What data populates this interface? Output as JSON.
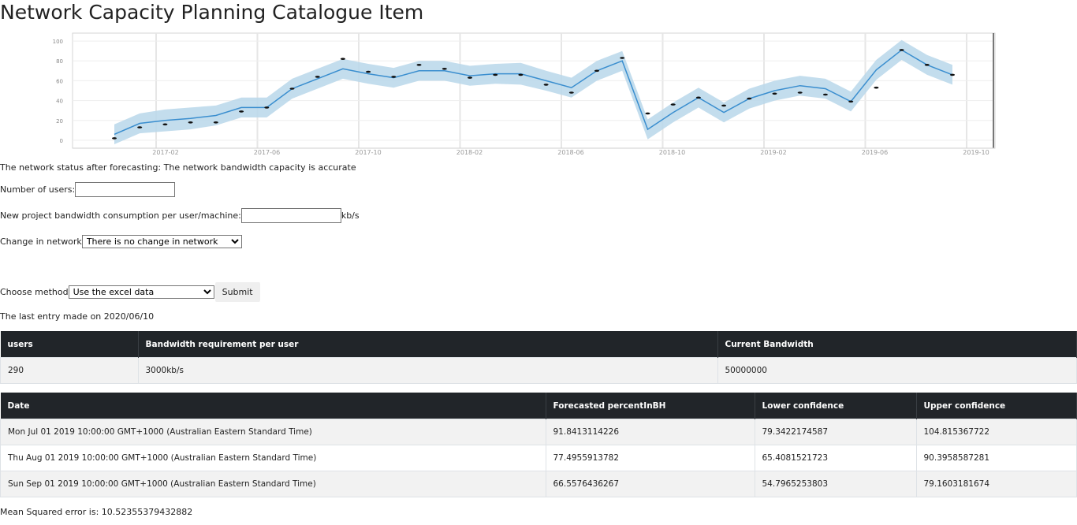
{
  "page": {
    "title": "Network Capacity Planning Catalogue Item"
  },
  "chart_data": {
    "type": "line",
    "x_tick_labels": [
      "2017-02",
      "2017-06",
      "2017-10",
      "2018-02",
      "2018-06",
      "2018-10",
      "2019-02",
      "2019-06",
      "2019-10"
    ],
    "y_tick_labels": [
      "0",
      "20",
      "40",
      "60",
      "80",
      "100"
    ],
    "ylim": [
      -8,
      108
    ],
    "xlim": [
      0,
      36
    ],
    "grid": true,
    "band_color": "#b9d7ea",
    "line_color": "#3a8ecf",
    "series": [
      {
        "x": [
          0,
          1,
          2,
          3,
          4,
          5,
          6,
          7,
          8,
          9,
          10,
          11,
          12,
          13,
          14,
          15,
          16,
          17,
          18,
          19,
          20,
          21,
          22,
          23,
          24,
          25,
          26,
          27,
          28,
          29,
          30,
          31,
          32,
          33
        ],
        "values": [
          6,
          17,
          20,
          22,
          25,
          33,
          33,
          52,
          62,
          72,
          67,
          63,
          70,
          70,
          65,
          67,
          67,
          60,
          53,
          70,
          80,
          11,
          28,
          43,
          28,
          42,
          50,
          55,
          52,
          39,
          71,
          91,
          76,
          66
        ],
        "lower": [
          -4,
          7,
          9,
          11,
          15,
          23,
          23,
          42,
          52,
          62,
          57,
          53,
          60,
          60,
          55,
          57,
          56,
          50,
          43,
          60,
          70,
          1,
          18,
          33,
          18,
          32,
          40,
          45,
          42,
          29,
          61,
          81,
          66,
          56
        ],
        "upper": [
          16,
          27,
          31,
          33,
          35,
          43,
          43,
          62,
          72,
          82,
          77,
          73,
          80,
          80,
          75,
          77,
          78,
          70,
          63,
          80,
          90,
          21,
          38,
          53,
          38,
          52,
          60,
          65,
          62,
          49,
          81,
          101,
          86,
          76
        ]
      },
      {
        "x": [
          0,
          1,
          2,
          3,
          4,
          5,
          6,
          7,
          8,
          9,
          10,
          11,
          12,
          13,
          14,
          15,
          16,
          17,
          18,
          19,
          20,
          21,
          22,
          23,
          24,
          25,
          26,
          27,
          28,
          29,
          30,
          31,
          32,
          33
        ],
        "values": [
          2,
          13,
          16,
          18,
          18,
          29,
          33,
          52,
          64,
          82,
          69,
          64,
          76,
          72,
          63,
          66,
          66,
          56,
          48,
          70,
          83,
          27,
          36,
          43,
          35,
          42,
          47,
          48,
          46,
          39,
          53,
          91,
          76,
          66
        ]
      }
    ]
  },
  "status": {
    "text": "The network status after forecasting: The network bandwidth capacity is accurate"
  },
  "form": {
    "users_label": "Number of users:",
    "users_value": "",
    "bandwidth_label": "New project bandwidth consumption per user/machine:",
    "bandwidth_value": "",
    "bandwidth_unit": "kb/s",
    "change_label": "Change in network",
    "change_selected": "There is no change in network",
    "method_label": "Choose method",
    "method_selected": "Use the excel data",
    "submit_label": "Submit"
  },
  "last_entry": {
    "text": "The last entry made on 2020/06/10"
  },
  "summary_table": {
    "headers": [
      "users",
      "Bandwidth requirement per user",
      "Current Bandwidth"
    ],
    "rows": [
      [
        "290",
        "3000kb/s",
        "50000000"
      ]
    ]
  },
  "forecast_table": {
    "headers": [
      "Date",
      "Forecasted percentInBH",
      "Lower confidence",
      "Upper confidence"
    ],
    "rows": [
      [
        "Mon Jul 01 2019 10:00:00 GMT+1000 (Australian Eastern Standard Time)",
        "91.8413114226",
        "79.3422174587",
        "104.815367722"
      ],
      [
        "Thu Aug 01 2019 10:00:00 GMT+1000 (Australian Eastern Standard Time)",
        "77.4955913782",
        "65.4081521723",
        "90.3958587281"
      ],
      [
        "Sun Sep 01 2019 10:00:00 GMT+1000 (Australian Eastern Standard Time)",
        "66.5576436267",
        "54.7965253803",
        "79.1603181674"
      ]
    ]
  },
  "mse": {
    "text": "Mean Squared error is: 10.52355379432882"
  }
}
